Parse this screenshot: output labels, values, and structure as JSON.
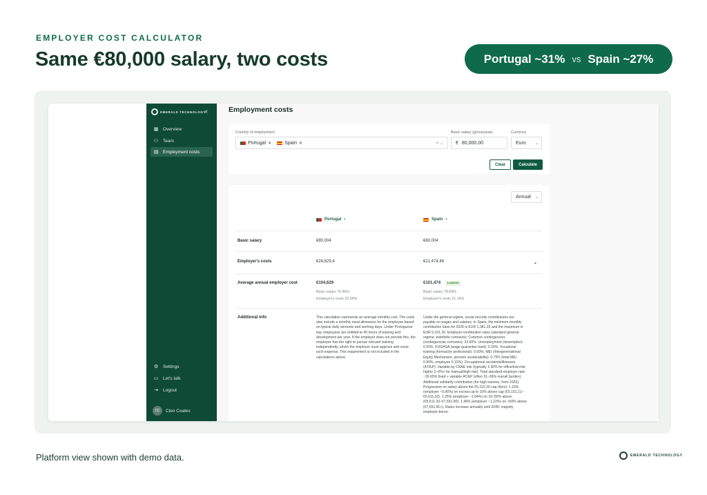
{
  "header": {
    "eyebrow": "EMPLOYER COST CALCULATOR",
    "headline": "Same €80,000 salary, two costs",
    "pill": {
      "left": "Portugal ~31%",
      "vs": "vs",
      "right": "Spain ~27%"
    }
  },
  "colors": {
    "brand": "#0f4a37",
    "accent": "#0e6a4a",
    "lowest_badge": "#3a8a2a"
  },
  "sidebar": {
    "logo": "EMERALD TECHNOLOGY",
    "collapse_icon": "«",
    "items": [
      {
        "label": "Overview",
        "icon": "grid-icon"
      },
      {
        "label": "Team",
        "icon": "people-icon"
      },
      {
        "label": "Employment costs",
        "icon": "calculator-icon",
        "active": true
      }
    ],
    "bottom": [
      {
        "label": "Settings",
        "icon": "gear-icon"
      },
      {
        "label": "Let's talk",
        "icon": "chat-icon"
      },
      {
        "label": "Logout",
        "icon": "logout-icon"
      }
    ],
    "user": {
      "initials": "CC",
      "name": "Cleo Coates"
    }
  },
  "main": {
    "title": "Employment costs",
    "form": {
      "country_label": "Country of employment",
      "countries": [
        "Portugal",
        "Spain"
      ],
      "clear_icon": "× ⌄",
      "salary_label": "Basic salary (gross/year)",
      "salary_currency_symbol": "€",
      "salary_value": "80,000.00",
      "currency_label": "Currency",
      "currency_value": "Euro",
      "clear_button": "Clear",
      "calculate_button": "Calculate"
    },
    "results": {
      "period": "Annual",
      "columns": [
        "Portugal",
        "Spain"
      ],
      "rows": {
        "basic_salary": {
          "label": "Basic salary",
          "pt": "€80,004",
          "es": "€80,004"
        },
        "employer_costs": {
          "label": "Employer's costs",
          "pt": "€24,629,4",
          "es": "€21,474,48"
        },
        "average": {
          "label": "Average annual employer cost",
          "pt": "€104,629",
          "pt_sub1": "Basic salary 76.46%",
          "pt_sub2": "Employer's costs 23.54%",
          "es": "€101,474",
          "es_badge": "Lowest",
          "es_sub1": "Basic salary 78.84%",
          "es_sub2": "Employer's costs 21.16%"
        },
        "additional": {
          "label": "Additional info",
          "pt": "This calculation represents an average monthly cost. The costs also include a monthly meal allowance for the employee based on typical daily amounts and working days. Under Portuguese law, employees are entitled to 40 hours of training and development per year. If the employer does not provide this, the employee has the right to pursue relevant training independently, which the employer must approve and cover such expense. This requirement is not included in the calculations above.",
          "es": "Under the general regime, social security contributions are payable on wages and salaries. In Spain, the minimum monthly contribution base for 2026 is EUR 1,381.20 and the maximum is EUR 5,101.20. Employer contribution rates (standard general regime, indefinite contracts): Common contingencies (contingencias comunes): 23.60%. Unemployment (desempleo): 5.50%. FOGASA (wage guarantee fund): 0.20%. Vocational training (formación profesional): 0.60%. MEI (Intergenerational Equity Mechanism, pension sustainability): 0.75% (total MEI 0.90%; employee 0.15%). Occupational accidents/illnesses (AT/EP): Variable by CNAE risk (typically 1.50% for office/low-risk; higher 2–6%+ for manual/high-risk). Total standard employer rate: ~30.65% fixed + variable AT/EP (often 31–36% overall burden). Additional solidarity contribution (for high earners, from 2026): Progressive on salary above the €5,101.20 cap (tiers): 1.15% (employer ~0.96%) on excess up to 10% above cap (€5,101.21–€5,611.32). 1.25% (employer ~1.04%) on 10–50% above (€5,611.33–€7,651.80). 1.46% (employer ~1.22%) on >50% above (€7,651.81+). Rates increase annually until 2045; majority employer-borne."
        }
      }
    }
  },
  "footer": {
    "note": "Platform view shown with demo data.",
    "brand": "EMERALD TECHNOLOGY"
  }
}
